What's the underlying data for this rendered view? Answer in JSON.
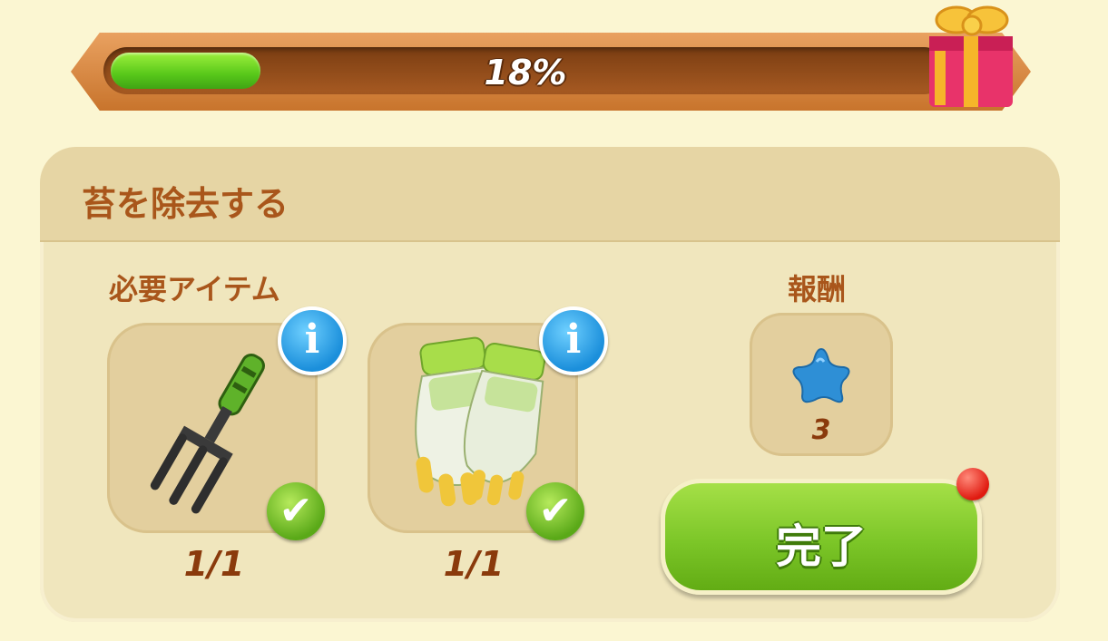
{
  "progress": {
    "percent_label": "18%",
    "fraction": 0.18
  },
  "task": {
    "title": "苔を除去する",
    "required_label": "必要アイテム",
    "reward_label": "報酬",
    "items": [
      {
        "icon": "garden-fork-icon",
        "count": "1/1",
        "info": "i",
        "check": "✔"
      },
      {
        "icon": "gardening-gloves-icon",
        "count": "1/1",
        "info": "i",
        "check": "✔"
      }
    ],
    "reward": {
      "icon": "blue-star-icon",
      "count": "3"
    },
    "done_label": "完了"
  },
  "colors": {
    "accent_text": "#a9561b",
    "button_green": "#7cc628",
    "progress_green": "#58c81a"
  }
}
